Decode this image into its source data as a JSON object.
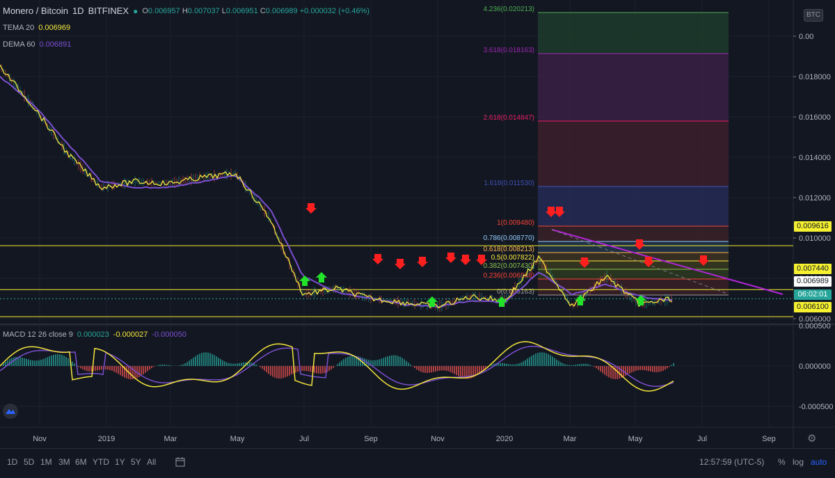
{
  "header": {
    "symbol": "Monero / Bitcoin",
    "interval": "1D",
    "exchange": "BITFINEX",
    "ohlc": {
      "o_label": "O",
      "o": "0.006957",
      "h_label": "H",
      "h": "0.007037",
      "l_label": "L",
      "l": "0.006951",
      "c_label": "C",
      "c": "0.006989",
      "change": "+0.000032 (+0.46%)"
    }
  },
  "indicators": {
    "tema": {
      "name": "TEMA 20",
      "value": "0.006969",
      "color": "#f5e63d"
    },
    "dema": {
      "name": "DEMA 60",
      "value": "0.006891",
      "color": "#7b4fd0"
    }
  },
  "currency_badge": "BTC",
  "price_axis": {
    "ticks": [
      "0.018000",
      "0.016000",
      "0.014000",
      "0.012000",
      "0.010000",
      "0.008000",
      "0.006000",
      "0.00"
    ],
    "tags": {
      "level_upper": "0.009616",
      "level_mid": "0.007440",
      "last_price": "0.006989",
      "countdown": "06:02:01",
      "level_lower": "0.006100"
    }
  },
  "fib": {
    "levels": [
      {
        "label": "4.236(0.020213)",
        "color": "#4caf50"
      },
      {
        "label": "3.618(0.018163)",
        "color": "#9c27b0"
      },
      {
        "label": "2.618(0.014847)",
        "color": "#e91e63"
      },
      {
        "label": "1.618(0.011530)",
        "color": "#3f51b5"
      },
      {
        "label": "1(0.009480)",
        "color": "#f44336"
      },
      {
        "label": "0.786(0.008770)",
        "color": "#90caf9"
      },
      {
        "label": "0.618(0.008213)",
        "color": "#ffb74d"
      },
      {
        "label": "0.5(0.007822)",
        "color": "#ffeb3b"
      },
      {
        "label": "0.382(0.007430)",
        "color": "#8bc34a"
      },
      {
        "label": "0.236(0.006948)",
        "color": "#f44336"
      },
      {
        "label": "0(0.006163)",
        "color": "#9e9e9e"
      }
    ]
  },
  "macd": {
    "name": "MACD 12 26 close 9",
    "hist": "0.000023",
    "macd": "-0.000027",
    "signal": "-0.000050",
    "ticks": [
      "0.000500",
      "0.000000",
      "-0.000500"
    ]
  },
  "time_axis": [
    "Nov",
    "2019",
    "Mar",
    "May",
    "Jul",
    "Sep",
    "Nov",
    "2020",
    "Mar",
    "May",
    "Jul",
    "Sep"
  ],
  "bottom_bar": {
    "ranges": [
      "1D",
      "5D",
      "1M",
      "3M",
      "6M",
      "YTD",
      "1Y",
      "5Y",
      "All"
    ],
    "clock": "12:57:59 (UTC-5)",
    "percent": "%",
    "log": "log",
    "auto": "auto"
  },
  "chart_data": {
    "type": "line",
    "title": "Monero / Bitcoin, 1D, BITFINEX",
    "x": [
      "2018-10",
      "2018-11",
      "2018-12",
      "2019-01",
      "2019-02",
      "2019-03",
      "2019-04",
      "2019-05",
      "2019-06",
      "2019-07",
      "2019-08",
      "2019-09",
      "2019-10",
      "2019-11",
      "2019-12",
      "2020-01",
      "2020-02",
      "2020-03",
      "2020-04",
      "2020-05",
      "2020-06"
    ],
    "series": [
      {
        "name": "TEMA 20",
        "values": [
          0.0185,
          0.0165,
          0.0142,
          0.0125,
          0.0128,
          0.0127,
          0.013,
          0.0132,
          0.011,
          0.0072,
          0.0075,
          0.007,
          0.0068,
          0.0066,
          0.0071,
          0.0069,
          0.009,
          0.0066,
          0.0081,
          0.0067,
          0.007
        ]
      },
      {
        "name": "DEMA 60",
        "values": [
          0.018,
          0.0166,
          0.0147,
          0.0128,
          0.0125,
          0.0125,
          0.0128,
          0.0131,
          0.0115,
          0.0081,
          0.0073,
          0.007,
          0.0067,
          0.0066,
          0.0069,
          0.0068,
          0.0083,
          0.0072,
          0.0077,
          0.0071,
          0.0069
        ]
      }
    ],
    "horizontal_levels": [
      0.009616,
      0.00744,
      0.0061
    ],
    "ylim": [
      0.0056,
      0.0206
    ],
    "grid": true
  }
}
